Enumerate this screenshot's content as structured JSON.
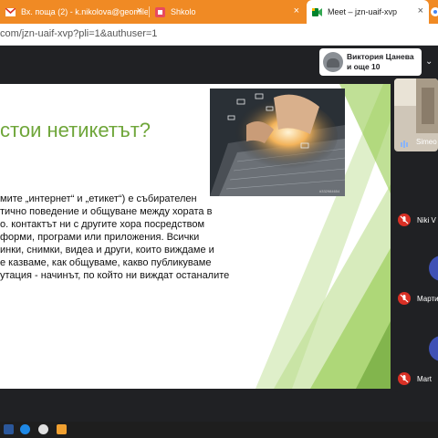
{
  "tabs": [
    {
      "title": "Вх. поща (2) - k.nikolova@geomile",
      "close": "×",
      "icon": "gmail-icon"
    },
    {
      "title": "Shkolo",
      "close": "×",
      "icon": "shkolo-icon"
    },
    {
      "title": "Meet – jzn-uaif-xvp",
      "close": "×",
      "icon": "meet-icon",
      "active": true
    },
    {
      "title": "",
      "close": "",
      "icon": "chrome-icon"
    }
  ],
  "address_bar": {
    "url": "com/jzn-uaif-xvp?pli=1&authuser=1"
  },
  "meet": {
    "presenter_names_line1": "Виктория Цанева",
    "presenter_names_line2": "и още 10",
    "participants": [
      {
        "name": "Simeo",
        "muted": false
      },
      {
        "name": "Niki V",
        "muted": true
      },
      {
        "name": "Марти",
        "muted": true
      },
      {
        "name": "Mart",
        "muted": true
      }
    ]
  },
  "slide": {
    "title": "стои нетикетът?",
    "body_lines": [
      "мите „интернет“ и „етикет“) е събирателен",
      "тично поведение и общуване между хората в",
      "о. контактът ни с другите хора посредством",
      "форми, програми или приложения. Всички",
      "инки, снимки, видеа и други, които виждаме и",
      "е казваме, как общуваме, какво публикуваме",
      "утация - начинът, по който ни виждат останалите"
    ],
    "photo_watermark": "#332984654"
  },
  "colors": {
    "tab_strip": "#f08a24",
    "slide_title": "#6fa63a",
    "slide_accent_green": "#8cc63f",
    "meet_background": "#202124",
    "mute_red": "#d93025"
  }
}
